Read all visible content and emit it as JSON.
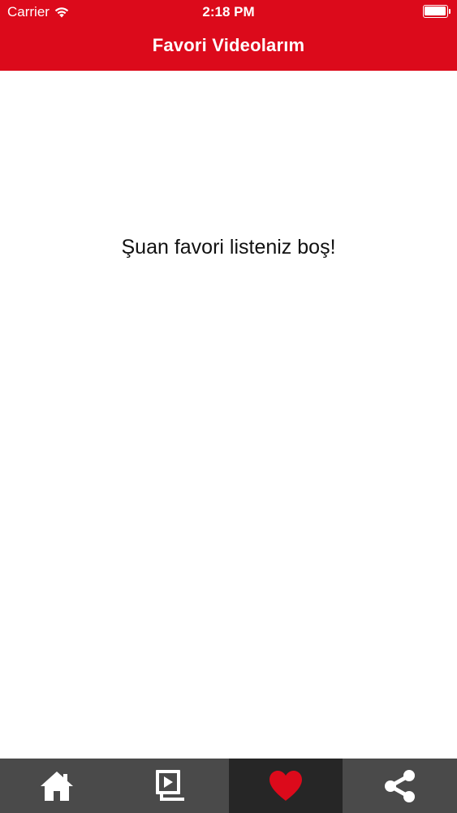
{
  "status_bar": {
    "carrier": "Carrier",
    "time": "2:18 PM"
  },
  "nav": {
    "title": "Favori Videolarım"
  },
  "main": {
    "empty_message": "Şuan favori listeniz boş!"
  },
  "tab_bar": {
    "tabs": [
      {
        "icon": "home-icon",
        "active": false
      },
      {
        "icon": "video-library-icon",
        "active": false
      },
      {
        "icon": "heart-icon",
        "active": true
      },
      {
        "icon": "share-icon",
        "active": false
      }
    ]
  },
  "colors": {
    "brand_red": "#dc0a1b",
    "tab_bar_bg": "#4a4a4a",
    "tab_active_bg": "#262626",
    "icon_white": "#ffffff"
  }
}
